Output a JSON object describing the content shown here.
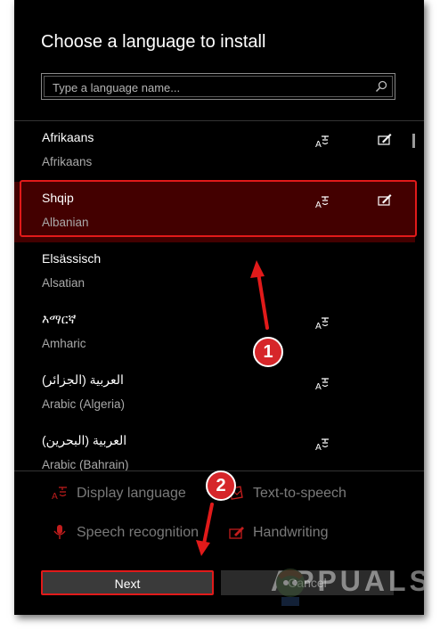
{
  "dialog": {
    "title": "Choose a language to install",
    "search": {
      "placeholder": "Type a language name...",
      "value": ""
    },
    "languages": [
      {
        "native": "Afrikaans",
        "english": "Afrikaans",
        "tts": true,
        "handwriting": true,
        "selected": false
      },
      {
        "native": "Shqip",
        "english": "Albanian",
        "tts": true,
        "handwriting": true,
        "selected": true
      },
      {
        "native": "Elsässisch",
        "english": "Alsatian",
        "tts": false,
        "handwriting": false,
        "selected": false
      },
      {
        "native": "እማርኛ",
        "english": "Amharic",
        "tts": true,
        "handwriting": false,
        "selected": false
      },
      {
        "native": "العربية (الجزائر)",
        "english": "Arabic (Algeria)",
        "tts": true,
        "handwriting": false,
        "selected": false
      },
      {
        "native": "العربية (البحرين)",
        "english": "Arabic (Bahrain)",
        "tts": true,
        "handwriting": false,
        "selected": false
      }
    ],
    "features": {
      "display_language": "Display language",
      "text_to_speech": "Text-to-speech",
      "speech_recognition": "Speech recognition",
      "handwriting": "Handwriting"
    },
    "buttons": {
      "next": "Next",
      "cancel": "Cancel"
    }
  },
  "annotations": {
    "step1": "1",
    "step2": "2"
  },
  "watermark": {
    "text": "APPUALS"
  },
  "colors": {
    "highlight": "#e11a1a",
    "selected_bg": "#430000",
    "badge": "#d6262a"
  }
}
